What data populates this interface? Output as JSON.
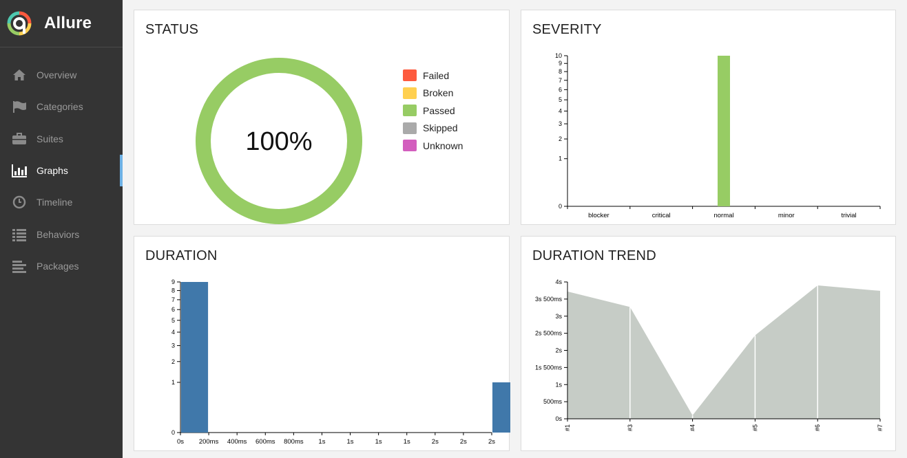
{
  "app": {
    "name": "Allure"
  },
  "sidebar": {
    "items": [
      {
        "label": "Overview",
        "icon": "home-icon"
      },
      {
        "label": "Categories",
        "icon": "flag-icon"
      },
      {
        "label": "Suites",
        "icon": "briefcase-icon"
      },
      {
        "label": "Graphs",
        "icon": "bar-chart-icon",
        "active": true
      },
      {
        "label": "Timeline",
        "icon": "clock-icon"
      },
      {
        "label": "Behaviors",
        "icon": "list-icon"
      },
      {
        "label": "Packages",
        "icon": "align-left-icon"
      }
    ]
  },
  "colors": {
    "sidebar_bg": "#343434",
    "active_accent": "#6eb2e6",
    "passed": "#97cc64",
    "failed": "#fd5a3e",
    "broken": "#ffd050",
    "skipped": "#aaaaaa",
    "unknown": "#d35ebe",
    "duration_bar": "#4078aa",
    "trend_area": "#c6ccc6"
  },
  "panels": {
    "status": {
      "title": "STATUS"
    },
    "severity": {
      "title": "SEVERITY"
    },
    "duration": {
      "title": "DURATION"
    },
    "trend": {
      "title": "DURATION TREND"
    }
  },
  "chart_data": [
    {
      "id": "status",
      "type": "pie",
      "title": "STATUS",
      "center_label": "100%",
      "categories": [
        "Failed",
        "Broken",
        "Passed",
        "Skipped",
        "Unknown"
      ],
      "values": [
        0,
        0,
        10,
        0,
        0
      ],
      "colors": [
        "#fd5a3e",
        "#ffd050",
        "#97cc64",
        "#aaaaaa",
        "#d35ebe"
      ],
      "legend": "right"
    },
    {
      "id": "severity",
      "type": "bar",
      "title": "SEVERITY",
      "categories": [
        "blocker",
        "critical",
        "normal",
        "minor",
        "trivial"
      ],
      "values": [
        0,
        0,
        10,
        0,
        0
      ],
      "ylim": [
        0,
        10
      ],
      "yticks": [
        0,
        1,
        2,
        3,
        4,
        5,
        6,
        7,
        8,
        9,
        10
      ],
      "yscale": "sqrt",
      "color": "#97cc64"
    },
    {
      "id": "duration",
      "type": "bar",
      "title": "DURATION",
      "xticks": [
        "0s",
        "200ms",
        "400ms",
        "600ms",
        "800ms",
        "1s",
        "1s",
        "1s",
        "1s",
        "2s",
        "2s",
        "2s"
      ],
      "bins": [
        {
          "x0": 0,
          "x1": 1,
          "count": 9
        },
        {
          "x0": 11,
          "x1": 12,
          "count": 1
        }
      ],
      "ylim": [
        0,
        9
      ],
      "yticks": [
        0,
        1,
        2,
        3,
        4,
        5,
        6,
        7,
        8,
        9
      ],
      "yscale": "sqrt",
      "color": "#4078aa"
    },
    {
      "id": "trend",
      "type": "area",
      "title": "DURATION TREND",
      "x": [
        "#1",
        "#3",
        "#4",
        "#5",
        "#6",
        "#7"
      ],
      "values_ms": [
        3720,
        3270,
        100,
        2440,
        3900,
        3740
      ],
      "ylim_ms": [
        0,
        4000
      ],
      "yticks": [
        "0s",
        "500ms",
        "1s",
        "1s 500ms",
        "2s",
        "2s 500ms",
        "3s",
        "3s 500ms",
        "4s"
      ],
      "color": "#c6ccc6"
    }
  ]
}
